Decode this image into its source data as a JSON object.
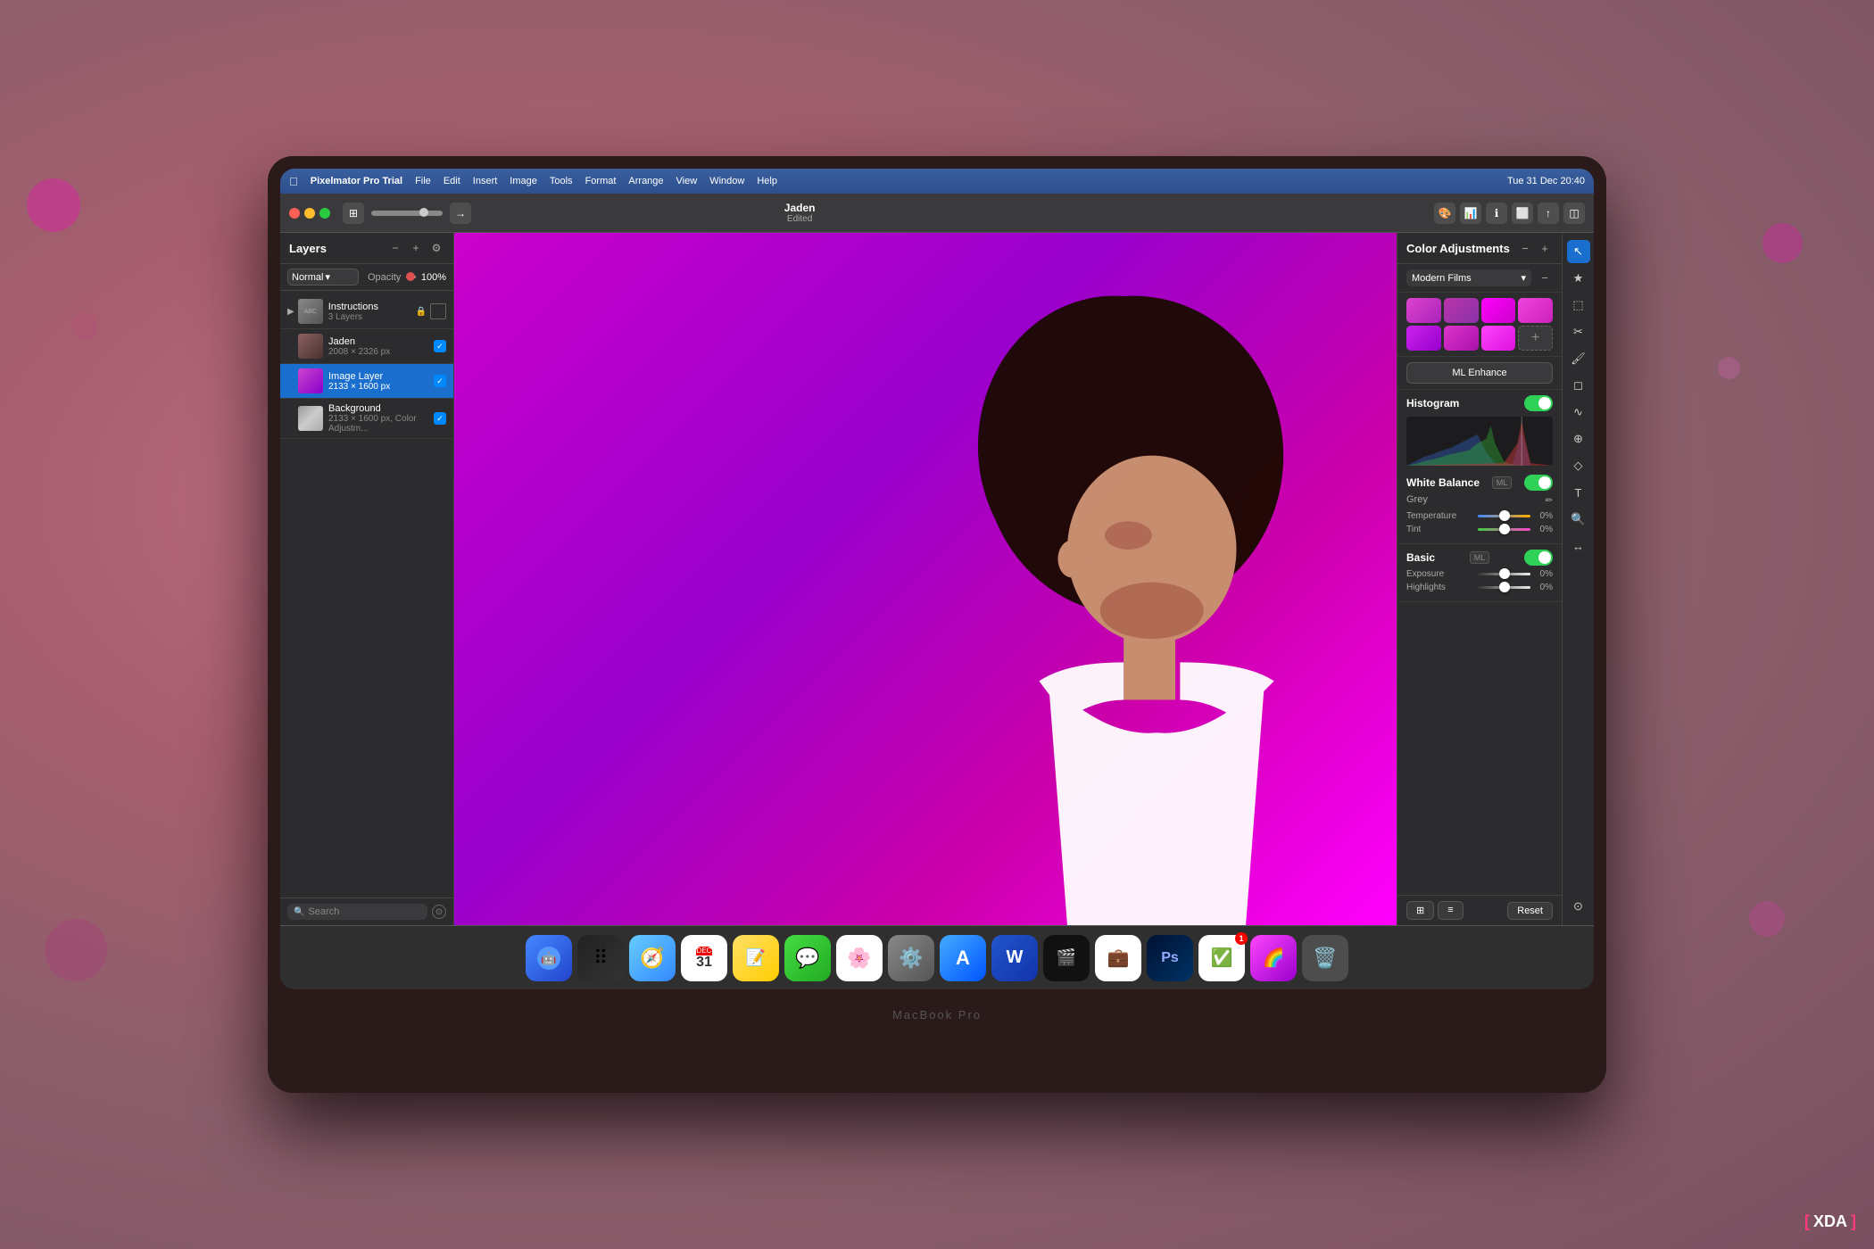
{
  "menubar": {
    "app_name": "Pixelmator Pro Trial",
    "menus": [
      "File",
      "Edit",
      "Insert",
      "Image",
      "Tools",
      "Format",
      "Arrange",
      "View",
      "Window",
      "Help"
    ],
    "datetime": "Tue 31 Dec  20:40"
  },
  "toolbar": {
    "document_name": "Jaden",
    "document_status": "Edited"
  },
  "layers_panel": {
    "title": "Layers",
    "blend_mode": "Normal",
    "opacity_label": "Opacity",
    "opacity_value": "100%",
    "layers": [
      {
        "name": "Instructions",
        "sub": "3 Layers",
        "type": "group",
        "locked": true,
        "selected": false
      },
      {
        "name": "Jaden",
        "sub": "2008 × 2326 px",
        "type": "image",
        "selected": false,
        "checked": true
      },
      {
        "name": "Image Layer",
        "sub": "2133 × 1600 px",
        "type": "color",
        "selected": true,
        "checked": true
      },
      {
        "name": "Background",
        "sub": "2133 × 1600 px, Color Adjustm...",
        "type": "bg",
        "selected": false,
        "checked": true
      }
    ],
    "search_placeholder": "Search"
  },
  "color_adjustments": {
    "title": "Color Adjustments",
    "preset": "Modern Films",
    "swatches": [
      "#cc44cc",
      "#aa44bb",
      "#ff00ff",
      "#dd44ee",
      "#aa22dd",
      "#bb33cc",
      "#ff44ff",
      "add"
    ],
    "ml_enhance_label": "ML Enhance",
    "histogram_label": "Histogram",
    "histogram_on": true,
    "white_balance_label": "White Balance",
    "white_balance_on": true,
    "grey_label": "Grey",
    "temperature_label": "Temperature",
    "temperature_value": "0%",
    "tint_label": "Tint",
    "tint_value": "0%",
    "basic_label": "Basic",
    "basic_on": true,
    "exposure_label": "Exposure",
    "exposure_value": "0%",
    "highlights_label": "Highlights",
    "highlights_value": "0%",
    "reset_label": "Reset"
  },
  "dock": {
    "items": [
      {
        "name": "Finder",
        "emoji": "🔵"
      },
      {
        "name": "Launchpad",
        "emoji": "🟣"
      },
      {
        "name": "Safari",
        "emoji": "🧭"
      },
      {
        "name": "Calendar",
        "emoji": "📅"
      },
      {
        "name": "Notes",
        "emoji": "📝"
      },
      {
        "name": "Messages",
        "emoji": "💬"
      },
      {
        "name": "Photos",
        "emoji": "🌸"
      },
      {
        "name": "System Preferences",
        "emoji": "⚙️"
      },
      {
        "name": "App Store",
        "emoji": "🅰"
      },
      {
        "name": "Word",
        "emoji": "📘"
      },
      {
        "name": "DaVinci Resolve",
        "emoji": "🎬"
      },
      {
        "name": "Slack",
        "emoji": "💼"
      },
      {
        "name": "Photoshop",
        "emoji": "🎨"
      },
      {
        "name": "Reminders",
        "emoji": "✅",
        "badge": "1"
      },
      {
        "name": "Pixelmator",
        "emoji": "🌈"
      },
      {
        "name": "Trash",
        "emoji": "🗑️"
      }
    ]
  },
  "laptop_label": "MacBook Pro",
  "xda_label": "XDA"
}
